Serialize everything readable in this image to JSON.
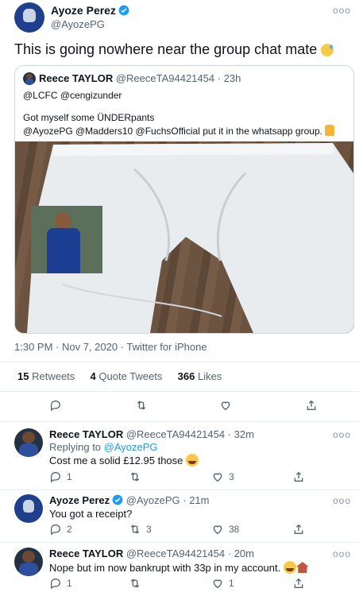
{
  "main_tweet": {
    "author_name": "Ayoze Perez",
    "handle": "@AyozePG",
    "text": "This is going nowhere near the group chat mate",
    "quoted": {
      "author_name": "Reece TAYLOR",
      "handle": "@ReeceTA94421454",
      "time": "23h",
      "replying": "@LCFC @cengizunder",
      "line1": "Got myself some ÜNDERpants",
      "line2": "@AyozePG @Madders10 @FuchsOfficial put it in the whatsapp group."
    },
    "timestamp": "1:30 PM · Nov 7, 2020 · Twitter for iPhone",
    "stats": {
      "retweets_count": "15",
      "retweets_label": "Retweets",
      "quotes_count": "4",
      "quotes_label": "Quote Tweets",
      "likes_count": "366",
      "likes_label": "Likes"
    }
  },
  "replies": [
    {
      "author_name": "Reece TAYLOR",
      "handle": "@ReeceTA94421454",
      "time": "· 32m",
      "replying_prefix": "Replying to",
      "replying_to": "@AyozePG",
      "text": "Cost me a solid £12.95 those",
      "reply_count": "1",
      "retweet_count": "",
      "like_count": "3"
    },
    {
      "author_name": "Ayoze Perez",
      "handle": "@AyozePG",
      "time": "· 21m",
      "text": "You got a receipt?",
      "reply_count": "2",
      "retweet_count": "3",
      "like_count": "38"
    },
    {
      "author_name": "Reece TAYLOR",
      "handle": "@ReeceTA94421454",
      "time": "· 20m",
      "text": "Nope but im now bankrupt with 33p in my account.",
      "reply_count": "1",
      "retweet_count": "",
      "like_count": "1"
    }
  ],
  "icons": {
    "verified": "verified-badge-icon",
    "more": "more-dots-icon",
    "reply": "reply-icon",
    "retweet": "retweet-icon",
    "like": "heart-icon",
    "share": "share-icon"
  },
  "colors": {
    "accent": "#1d9bf0",
    "text": "#0f1419",
    "secondary": "#536471",
    "divider": "#e6ecf0"
  }
}
